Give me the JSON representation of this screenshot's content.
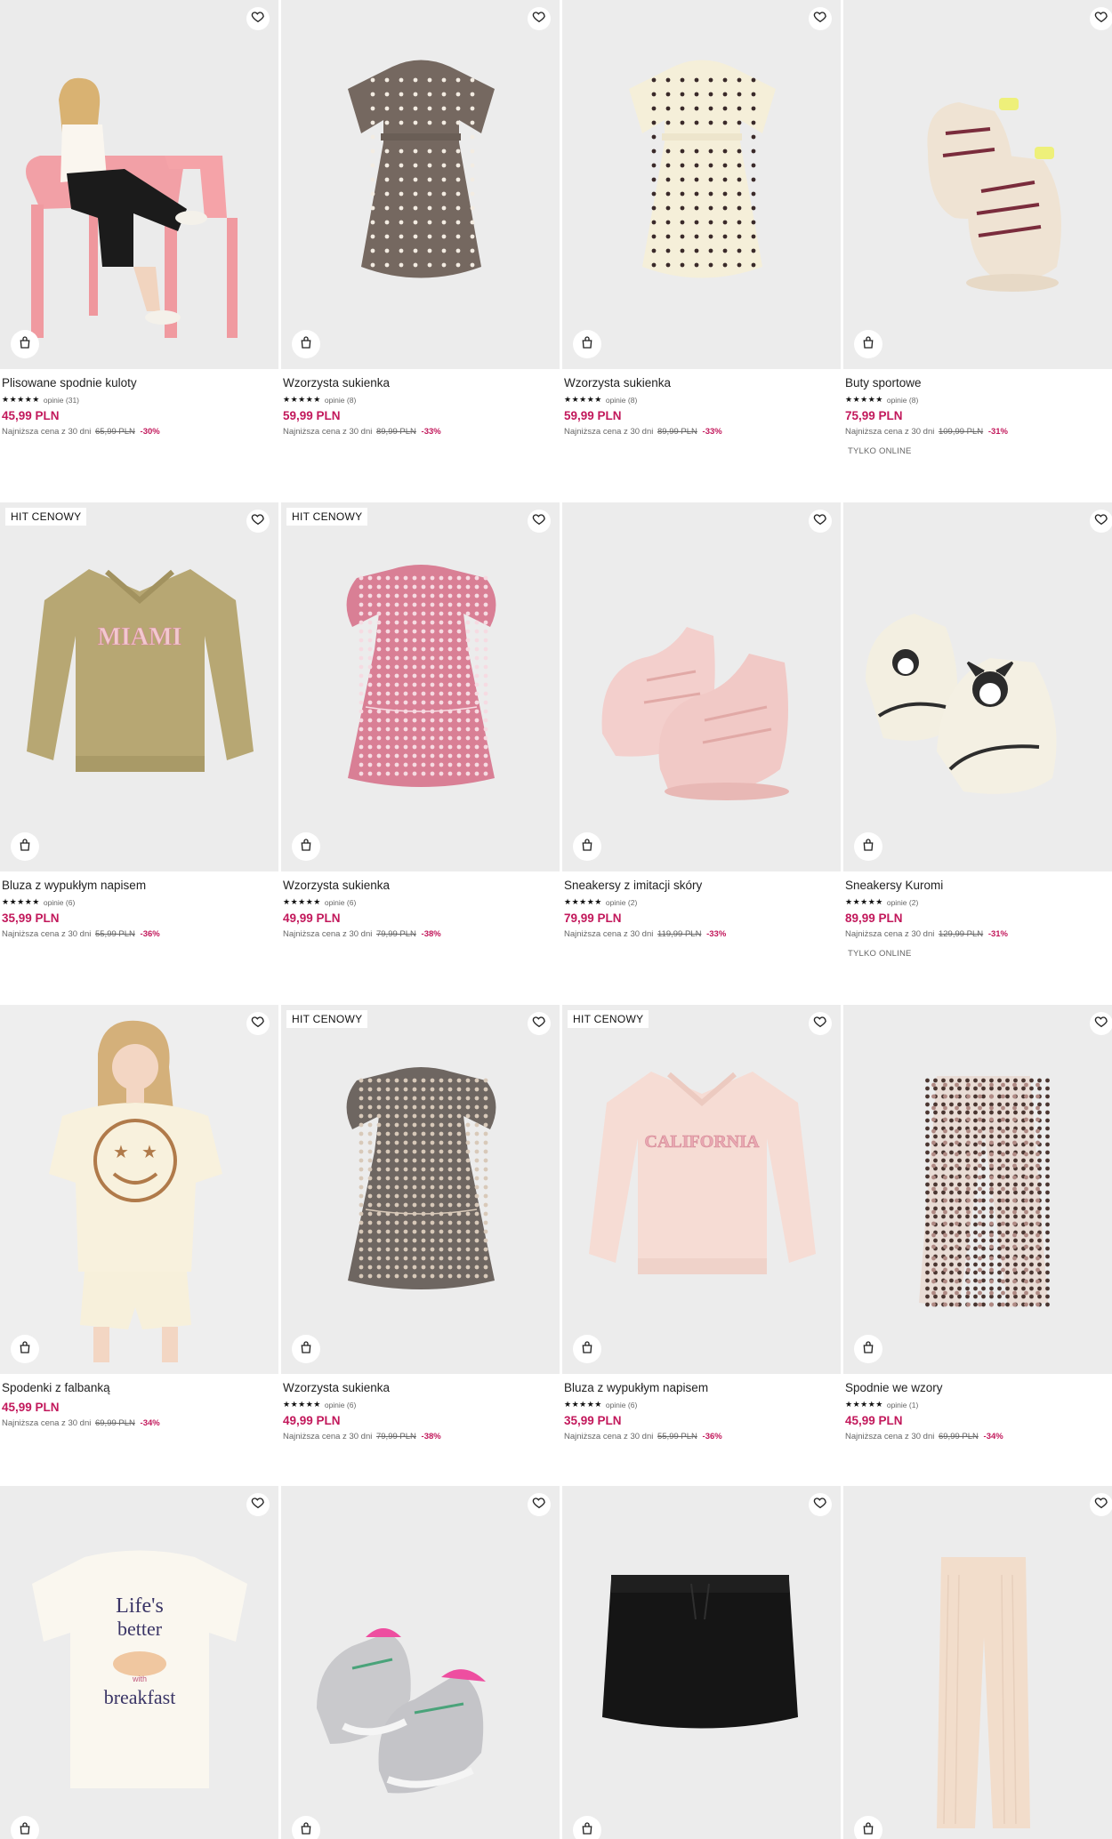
{
  "labels": {
    "lowest_prefix": "Najniższa cena z 30 dni",
    "stars": "★★★★★"
  },
  "products": [
    {
      "name": "Plisowane spodnie kuloty",
      "reviews": "opinie (31)",
      "price": "45,99 PLN",
      "old_price": "65,99 PLN",
      "discount": "-30%",
      "badge": "",
      "online": "",
      "image": "girl-on-pink-chair"
    },
    {
      "name": "Wzorzysta sukienka",
      "reviews": "opinie (8)",
      "price": "59,99 PLN",
      "old_price": "89,99 PLN",
      "discount": "-33%",
      "badge": "",
      "online": "",
      "image": "brown-dotted-dress"
    },
    {
      "name": "Wzorzysta sukienka",
      "reviews": "opinie (8)",
      "price": "59,99 PLN",
      "old_price": "89,99 PLN",
      "discount": "-33%",
      "badge": "",
      "online": "",
      "image": "cream-dotted-dress"
    },
    {
      "name": "Buty sportowe",
      "reviews": "opinie (8)",
      "price": "75,99 PLN",
      "old_price": "109,99 PLN",
      "discount": "-31%",
      "badge": "",
      "online": "TYLKO ONLINE",
      "image": "beige-sneakers"
    },
    {
      "name": "Bluza z wypukłym napisem",
      "reviews": "opinie (6)",
      "price": "35,99 PLN",
      "old_price": "55,99 PLN",
      "discount": "-36%",
      "badge": "HIT CENOWY",
      "online": "",
      "image": "miami-sweatshirt"
    },
    {
      "name": "Wzorzysta sukienka",
      "reviews": "opinie (6)",
      "price": "49,99 PLN",
      "old_price": "79,99 PLN",
      "discount": "-38%",
      "badge": "HIT CENOWY",
      "online": "",
      "image": "pink-floral-dress"
    },
    {
      "name": "Sneakersy z imitacji skóry",
      "reviews": "opinie (2)",
      "price": "79,99 PLN",
      "old_price": "119,99 PLN",
      "discount": "-33%",
      "badge": "",
      "online": "",
      "image": "pink-sneakers"
    },
    {
      "name": "Sneakersy Kuromi",
      "reviews": "opinie (2)",
      "price": "89,99 PLN",
      "old_price": "129,99 PLN",
      "discount": "-31%",
      "badge": "",
      "online": "TYLKO ONLINE",
      "image": "kuromi-sneakers"
    },
    {
      "name": "Spodenki z falbanką",
      "reviews": "",
      "price": "45,99 PLN",
      "old_price": "69,99 PLN",
      "discount": "-34%",
      "badge": "",
      "online": "",
      "image": "girl-smiley-tee"
    },
    {
      "name": "Wzorzysta sukienka",
      "reviews": "opinie (6)",
      "price": "49,99 PLN",
      "old_price": "79,99 PLN",
      "discount": "-38%",
      "badge": "HIT CENOWY",
      "online": "",
      "image": "grey-floral-dress"
    },
    {
      "name": "Bluza z wypukłym napisem",
      "reviews": "opinie (6)",
      "price": "35,99 PLN",
      "old_price": "55,99 PLN",
      "discount": "-36%",
      "badge": "HIT CENOWY",
      "online": "",
      "image": "california-sweatshirt"
    },
    {
      "name": "Spodnie we wzory",
      "reviews": "opinie (1)",
      "price": "45,99 PLN",
      "old_price": "69,99 PLN",
      "discount": "-34%",
      "badge": "",
      "online": "",
      "image": "patterned-trousers"
    },
    {
      "name": "",
      "reviews": "",
      "price": "",
      "old_price": "",
      "discount": "",
      "badge": "",
      "online": "",
      "image": "lifes-better-tee",
      "art_text": [
        "Life's",
        "better",
        "with",
        "breakfast"
      ]
    },
    {
      "name": "",
      "reviews": "",
      "price": "",
      "old_price": "",
      "discount": "",
      "badge": "",
      "online": "",
      "image": "grey-pink-sneakers"
    },
    {
      "name": "",
      "reviews": "",
      "price": "",
      "old_price": "",
      "discount": "",
      "badge": "",
      "online": "",
      "image": "black-skirt"
    },
    {
      "name": "",
      "reviews": "",
      "price": "",
      "old_price": "",
      "discount": "",
      "badge": "",
      "online": "",
      "image": "beige-knit-trousers"
    }
  ],
  "art_text": {
    "miami": "MIAMI",
    "california": "CALIFORNIA"
  },
  "colors": {
    "price": "#c2185b",
    "image_bg": "#ececec"
  }
}
